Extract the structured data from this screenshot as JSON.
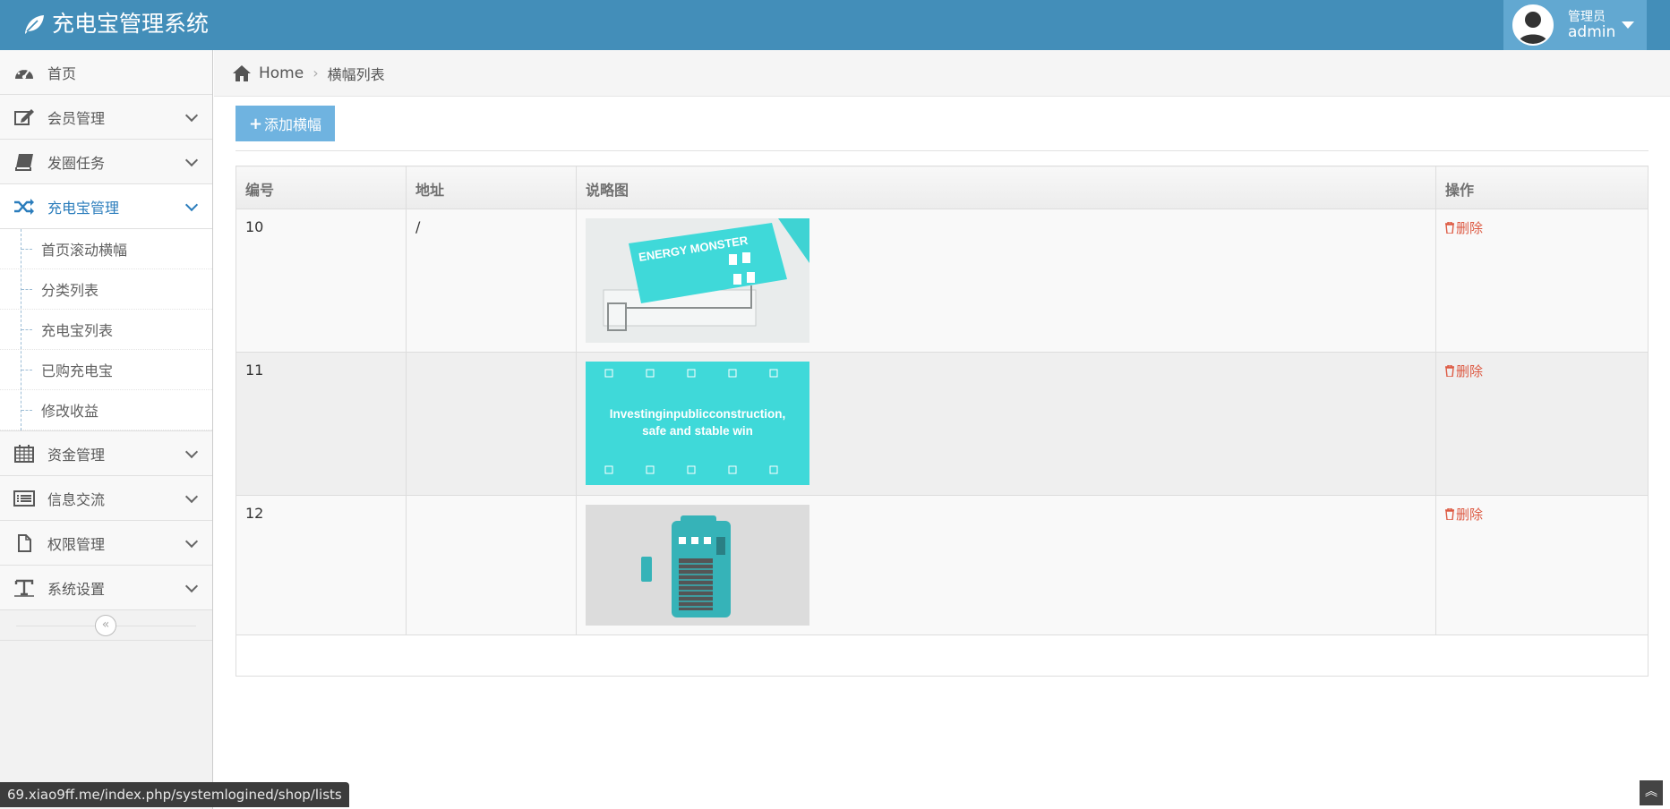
{
  "navbar": {
    "title": "充电宝管理系统",
    "user_role": "管理员",
    "user_name": "admin"
  },
  "sidebar": {
    "items": [
      {
        "label": "首页",
        "icon": "dashboard-icon"
      },
      {
        "label": "会员管理",
        "icon": "edit-icon"
      },
      {
        "label": "发圈任务",
        "icon": "book-icon"
      },
      {
        "label": "充电宝管理",
        "icon": "random-icon"
      },
      {
        "label": "资金管理",
        "icon": "calendar-icon"
      },
      {
        "label": "信息交流",
        "icon": "list-icon"
      },
      {
        "label": "权限管理",
        "icon": "file-icon"
      },
      {
        "label": "系统设置",
        "icon": "text-icon"
      }
    ],
    "submenu": [
      "首页滚动横幅",
      "分类列表",
      "充电宝列表",
      "已购充电宝",
      "修改收益"
    ]
  },
  "breadcrumb": {
    "home": "Home",
    "current": "横幅列表"
  },
  "toolbar": {
    "add_label": "添加横幅"
  },
  "table": {
    "headers": [
      "编号",
      "地址",
      "说略图",
      "操作"
    ],
    "rows": [
      {
        "id": "10",
        "address": "/",
        "image": "energy-monster-banner",
        "action": "删除"
      },
      {
        "id": "11",
        "address": "",
        "image": "investing-banner",
        "action": "删除"
      },
      {
        "id": "12",
        "address": "",
        "image": "powerbank-station-banner",
        "action": "删除"
      }
    ]
  },
  "banner_texts": {
    "energy_title": "ENERGY MONSTER",
    "investing_line1": "Investinginpublicconstruction,",
    "investing_line2": "safe and stable win"
  },
  "statusbar": {
    "url": "69.xiao9ff.me/index.php/systemlogined/shop/lists"
  },
  "colors": {
    "navbar": "#438eb9",
    "user_box": "#62a8d1",
    "add_button": "#6fb3e0",
    "delete": "#dd5a43",
    "active": "#2b7dbc"
  }
}
